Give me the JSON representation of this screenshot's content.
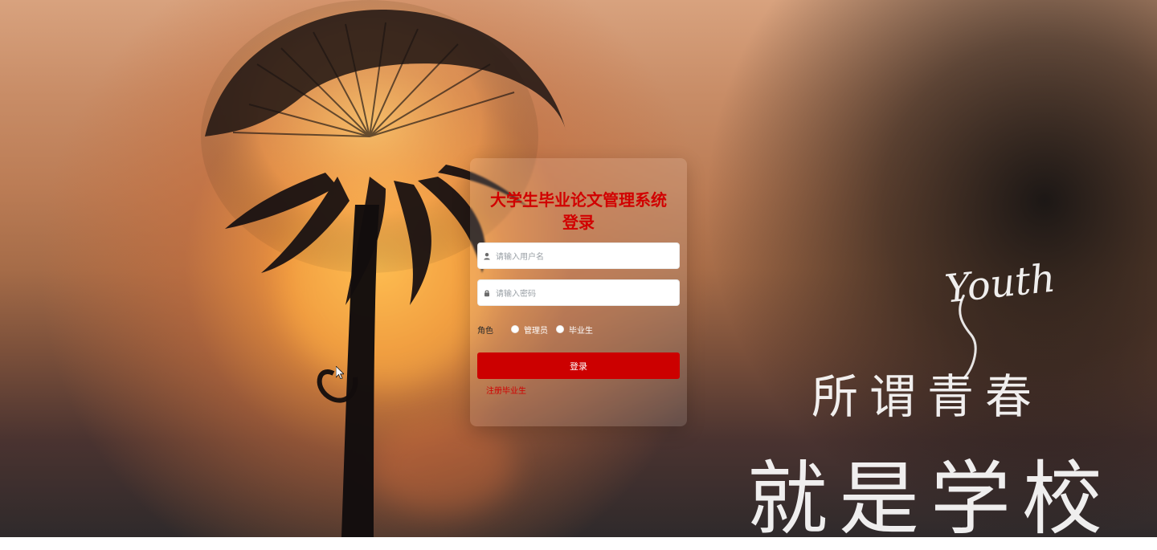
{
  "app": {
    "title_line1": "大学生毕业论文管理系统",
    "title_line2": "登录"
  },
  "form": {
    "username": {
      "placeholder": "请输入用户名",
      "value": ""
    },
    "password": {
      "placeholder": "请输入密码",
      "value": ""
    },
    "role": {
      "label": "角色",
      "options": [
        "管理员",
        "毕业生"
      ],
      "selected": ""
    },
    "login_button_label": "登录",
    "register_link_label": "注册毕业生"
  },
  "background": {
    "youth_text": "Youth",
    "slogan_line1": "所谓青春",
    "slogan_line2": "就是学校"
  },
  "icons": {
    "username": "user-icon",
    "password": "lock-icon"
  },
  "colors": {
    "accent": "#cc0000",
    "title": "#d10000",
    "link": "#d10000"
  }
}
